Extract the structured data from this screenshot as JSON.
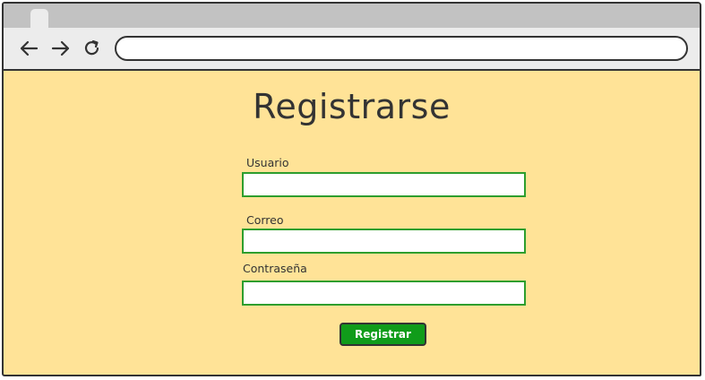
{
  "browser": {
    "back_icon": "arrow-left-icon",
    "forward_icon": "arrow-right-icon",
    "reload_icon": "reload-icon",
    "url": ""
  },
  "form": {
    "title": "Registrarse",
    "fields": [
      {
        "label": "Usuario",
        "value": ""
      },
      {
        "label": "Correo",
        "value": ""
      },
      {
        "label": "Contraseña",
        "value": ""
      }
    ],
    "submit_label": "Registrar"
  },
  "colors": {
    "page_background": "#ffe397",
    "field_border": "#2e9e2e",
    "button_background": "#109c1a",
    "chrome_background": "#ececec",
    "tabstrip_background": "#c2c2c2"
  }
}
